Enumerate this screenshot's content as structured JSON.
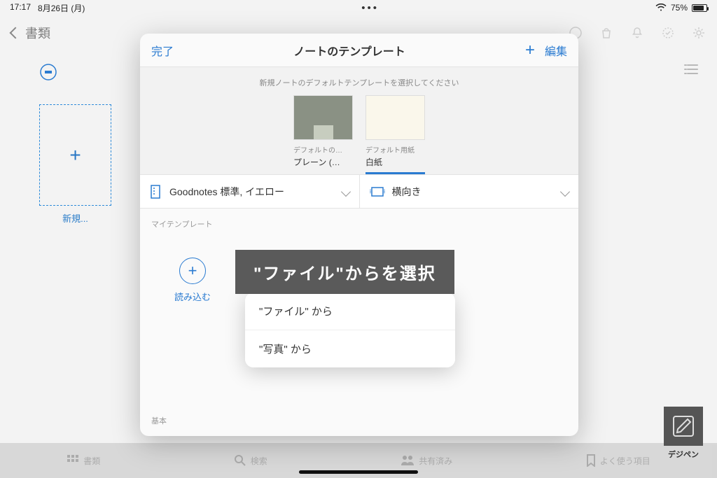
{
  "status": {
    "time": "17:17",
    "date": "8月26日 (月)",
    "battery": "75%"
  },
  "nav": {
    "back": "書類"
  },
  "shelf": {
    "new_label": "新規..."
  },
  "sheet": {
    "done": "完了",
    "title": "ノートのテンプレート",
    "edit": "編集",
    "hint": "新規ノートのデフォルトテンプレートを選択してください",
    "templates": [
      {
        "caption": "デフォルトの…",
        "name": "プレーン (…"
      },
      {
        "caption": "デフォルト用紙",
        "name": "白紙"
      }
    ],
    "selector1": "Goodnotes 標準, イエロー",
    "selector2": "横向き",
    "section_my": "マイテンプレート",
    "import_label": "読み込む",
    "popover": {
      "item1": "\"ファイル\" から",
      "item2": "\"写真\" から"
    },
    "section_basic": "基本"
  },
  "callout": "\"ファイル\"からを選択",
  "tabs": {
    "t1": "書類",
    "t2": "検索",
    "t3": "共有済み",
    "t4": "よく使う項目"
  },
  "watermark": "デジペン"
}
